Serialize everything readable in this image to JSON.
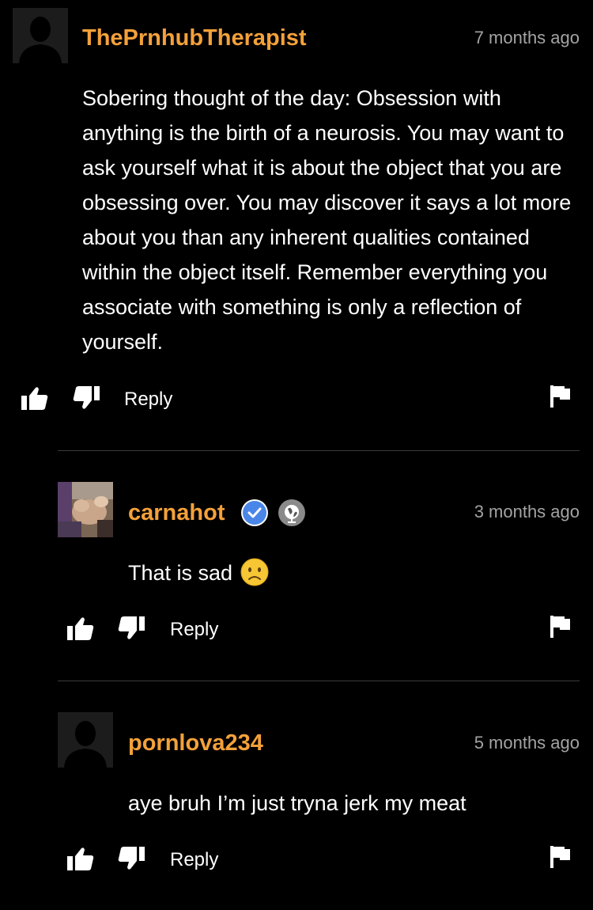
{
  "comments": [
    {
      "username": "ThePrnhubTherapist",
      "time": "7 months ago",
      "text": "Sobering thought of the day: Obsession with anything is the birth of a neurosis. You may want to ask yourself what it is about the object that you are obsessing over. You may discover it says a lot more about you than any inherent qualities contained within the object itself. Remember everything you associate with something is only a reflection of yourself.",
      "reply_label": "Reply"
    },
    {
      "username": "carnahot",
      "time": "3 months ago",
      "text": "That is sad",
      "reply_label": "Reply",
      "badges": [
        "verified-icon",
        "globe-icon"
      ],
      "emoji": "sad-face-emoji"
    },
    {
      "username": "pornlova234",
      "time": "5 months ago",
      "text": "aye bruh I’m just tryna jerk my meat",
      "reply_label": "Reply"
    }
  ],
  "colors": {
    "background": "#000000",
    "username": "#f4a13a",
    "timestamp": "#a3a3a3",
    "divider": "#3a3a3a",
    "verified": "#4a86e8"
  }
}
